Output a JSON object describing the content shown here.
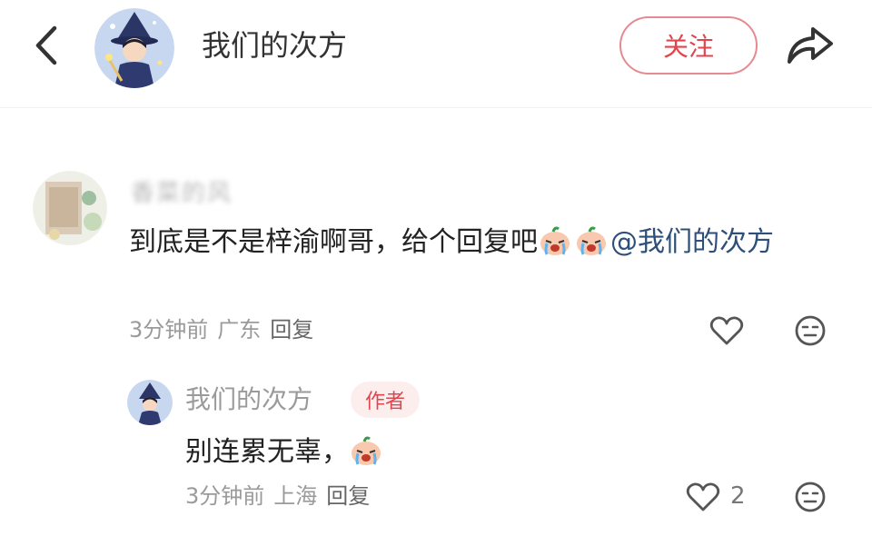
{
  "header": {
    "back_icon": "chevron-left-icon",
    "title": "我们的次方",
    "follow_label": "关注",
    "share_icon": "share-arrow-icon",
    "accent": "#e0464e"
  },
  "comment": {
    "author_name": "香菜的风",
    "text_before": "到底是不是梓渝啊哥，给个回复吧",
    "emoji_name": "crying-face-emoji",
    "mention": "@我们的次方",
    "time": "3分钟前",
    "location": "广东",
    "reply_label": "回复"
  },
  "reply": {
    "author_name": "我们的次方",
    "badge": "作者",
    "text": "别连累无辜，",
    "emoji_name": "crying-face-emoji",
    "time": "3分钟前",
    "location": "上海",
    "reply_label": "回复",
    "like_count": "2"
  }
}
